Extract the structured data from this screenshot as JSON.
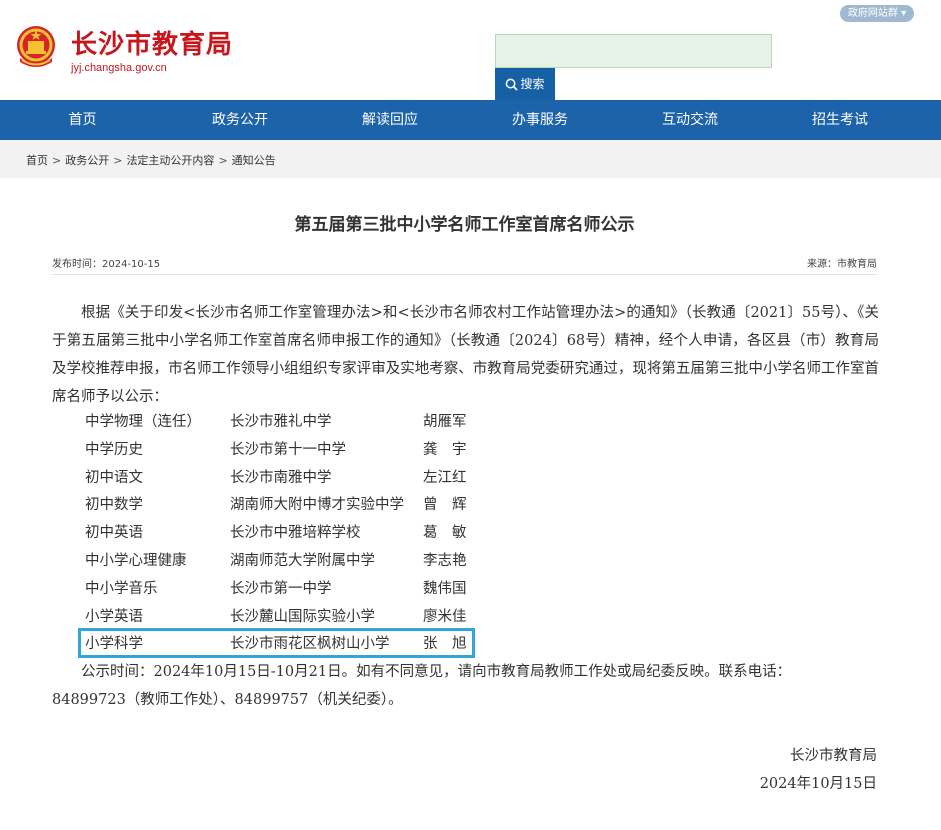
{
  "header": {
    "site_title": "长沙市教育局",
    "site_domain": "jyj.changsha.gov.cn",
    "site_group": "政府网站群 ▾",
    "search_placeholder": "",
    "search_label": "搜索"
  },
  "nav": {
    "items": [
      "首页",
      "政务公开",
      "解读回应",
      "办事服务",
      "互动交流",
      "招生考试"
    ]
  },
  "breadcrumb": [
    "首页",
    "政务公开",
    "法定主动公开内容",
    "通知公告"
  ],
  "breadcrumb_sep": ">",
  "article": {
    "title": "第五届第三批中小学名师工作室首席名师公示",
    "publish_time": "发布时间：2024-10-15",
    "source": "来源：市教育局",
    "intro": "根据《关于印发<长沙市名师工作室管理办法>和<长沙市名师农村工作站管理办法>的通知》（长教通〔2021〕55号）、《关于第五届第三批中小学名师工作室首席名师申报工作的通知》（长教通〔2024〕68号）精神，经个人申请，各区县（市）教育局及学校推荐申报，市名师工作领导小组组织专家评审及实地考察、市教育局党委研究通过，现将第五届第三批中小学名师工作室首席名师予以公示：",
    "rows": [
      {
        "subject": "中学物理（连任）",
        "school": "长沙市雅礼中学",
        "name": "胡雁军"
      },
      {
        "subject": "中学历史",
        "school": "长沙市第十一中学",
        "name": "龚　宇"
      },
      {
        "subject": "初中语文",
        "school": "长沙市南雅中学",
        "name": "左江红"
      },
      {
        "subject": "初中数学",
        "school": "湖南师大附中博才实验中学",
        "name": "曾　辉"
      },
      {
        "subject": "初中英语",
        "school": "长沙市中雅培粹学校",
        "name": "葛　敏"
      },
      {
        "subject": "中小学心理健康",
        "school": "湖南师范大学附属中学",
        "name": "李志艳"
      },
      {
        "subject": "中小学音乐",
        "school": "长沙市第一中学",
        "name": "魏伟国"
      },
      {
        "subject": "小学英语",
        "school": "长沙麓山国际实验小学",
        "name": "廖米佳"
      },
      {
        "subject": "小学科学",
        "school": "长沙市雨花区枫树山小学",
        "name": "张　旭"
      }
    ],
    "notice_line1": "公示时间：2024年10月15日-10月21日。如有不同意见，请向市教育局教师工作处或局纪委反映。联系电话：",
    "notice_line2": "84899723（教师工作处）、84899757（机关纪委）。",
    "sign_org": "长沙市教育局",
    "sign_date": "2024年10月15日"
  },
  "colors": {
    "brand_red": "#c8161d",
    "nav_blue": "#1d63aa",
    "highlight": "#33a3dc"
  }
}
